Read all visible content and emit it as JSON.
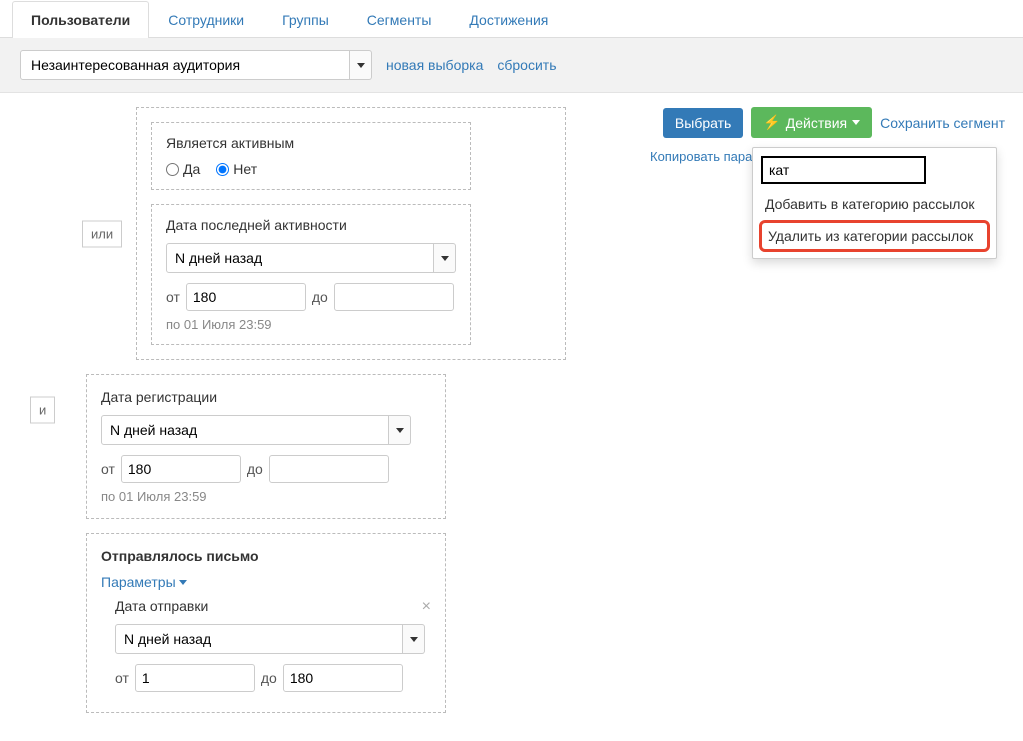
{
  "tabs": {
    "users": "Пользователи",
    "staff": "Сотрудники",
    "groups": "Группы",
    "segments": "Сегменты",
    "achievements": "Достижения"
  },
  "filter": {
    "segment_value": "Незаинтересованная аудитория",
    "new_selection": "новая выборка",
    "reset": "сбросить"
  },
  "actions": {
    "select": "Выбрать",
    "actions": "Действия",
    "save_segment": "Сохранить сегмент",
    "copy_params": "Копировать пара"
  },
  "dropdown": {
    "search": "кат",
    "add": "Добавить в категорию рассылок",
    "remove": "Удалить из категории рассылок"
  },
  "operators": {
    "or": "или",
    "and": "и"
  },
  "rule1": {
    "title": "Является активным",
    "yes": "Да",
    "no": "Нет"
  },
  "rule2": {
    "title": "Дата последней активности",
    "period": "N дней назад",
    "from_label": "от",
    "to_label": "до",
    "from_value": "180",
    "to_value": "",
    "note": "по 01 Июля 23:59"
  },
  "rule3": {
    "title": "Дата регистрации",
    "period": "N дней назад",
    "from_label": "от",
    "to_label": "до",
    "from_value": "180",
    "to_value": "",
    "note": "по 01 Июля 23:59"
  },
  "rule4": {
    "title": "Отправлялось письмо",
    "params": "Параметры",
    "sub_title": "Дата отправки",
    "period": "N дней назад",
    "from_label": "от",
    "to_label": "до",
    "from_value": "1",
    "to_value": "180"
  }
}
